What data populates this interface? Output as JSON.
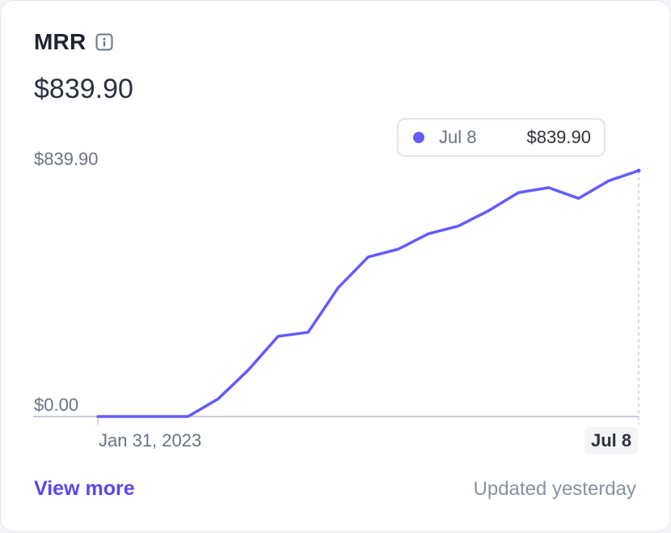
{
  "card": {
    "title": "MRR",
    "info_icon": "info-icon",
    "value": "$839.90",
    "view_more_label": "View more",
    "updated_text": "Updated yesterday"
  },
  "tooltip": {
    "date": "Jul 8",
    "value": "$839.90"
  },
  "chart_data": {
    "type": "line",
    "title": "",
    "xlabel": "",
    "ylabel": "",
    "x_start_label": "Jan 31, 2023",
    "x_end_label": "Jul 8",
    "y_max_label": "$839.90",
    "y_min_label": "$0.00",
    "ylim": [
      0,
      839.9
    ],
    "grid": false,
    "series": [
      {
        "color": "#635bff",
        "values": [
          0,
          0,
          0,
          0,
          60,
          158,
          274,
          288,
          440,
          545,
          572,
          624,
          651,
          703,
          765,
          782,
          745,
          805,
          839.9
        ]
      }
    ]
  },
  "colors": {
    "accent": "#635bff",
    "link": "#5a46ee",
    "muted_text": "#687385",
    "axis": "#c7ccd6"
  }
}
